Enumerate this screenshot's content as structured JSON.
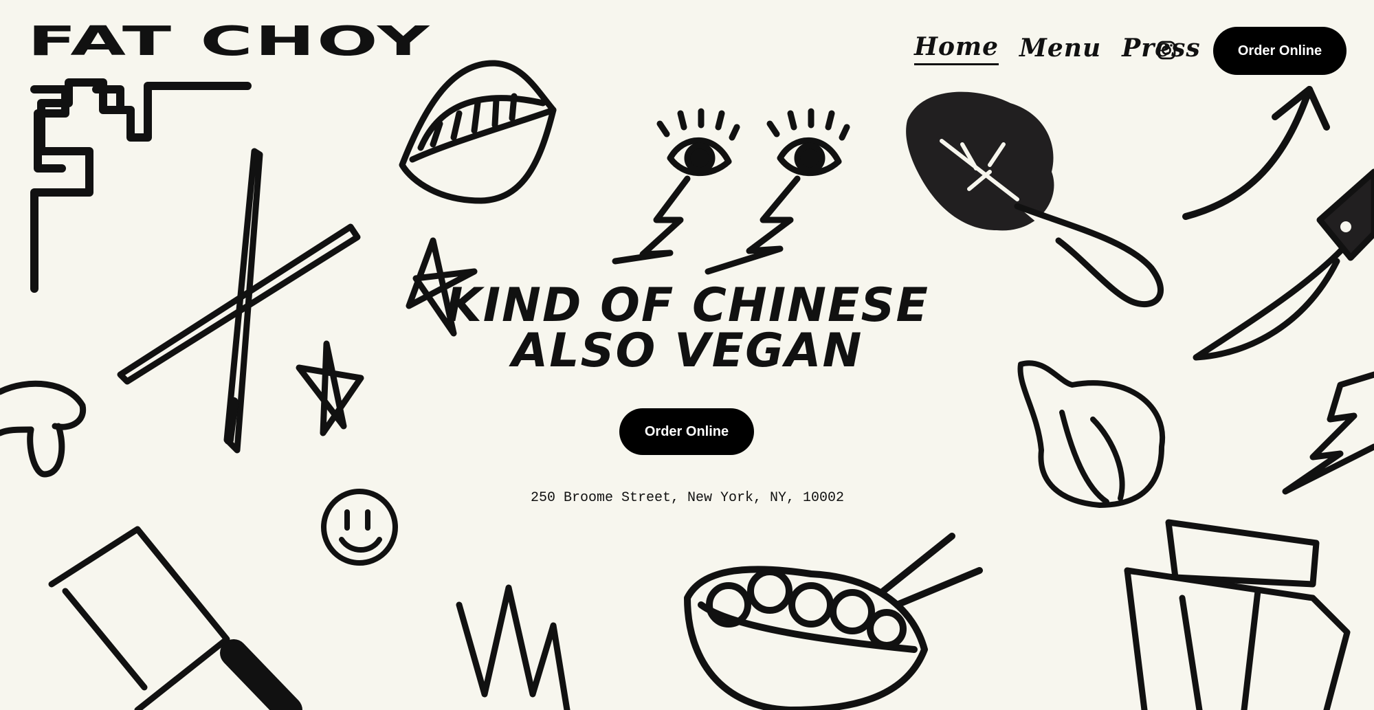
{
  "brand": {
    "logo_text": "FAT CHOY"
  },
  "nav": {
    "items": [
      {
        "label": "Home",
        "active": true
      },
      {
        "label": "Menu",
        "active": false
      },
      {
        "label": "Press",
        "active": false
      }
    ],
    "social_icon": "instagram-icon",
    "order_label": "Order Online"
  },
  "hero": {
    "title_line1": "KIND OF CHINESE",
    "title_line2": "ALSO VEGAN",
    "order_label": "Order Online",
    "address": "250 Broome Street, New York, NY, 10002"
  },
  "doodle_icons": [
    "maze-corner-icon",
    "lips-icon",
    "eyes-lightning-icon",
    "bok-choy-icon",
    "arrow-icon",
    "knife-icon",
    "chopsticks-icon",
    "star-icon",
    "mushroom-icon",
    "smiley-icon",
    "garlic-icon",
    "lightning-icon",
    "cleaver-icon",
    "scribble-icon",
    "noodle-bowl-icon",
    "takeout-box-icon"
  ],
  "colors": {
    "background": "#f7f6ee",
    "ink": "#111111",
    "button": "#000000",
    "button_text": "#ffffff"
  }
}
